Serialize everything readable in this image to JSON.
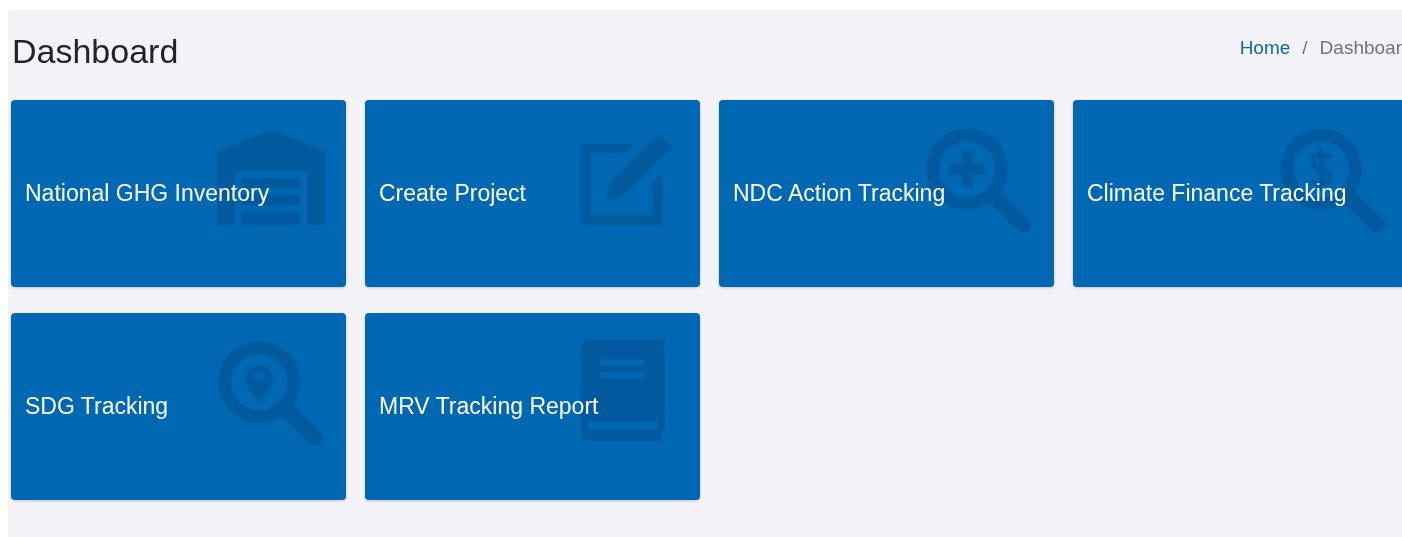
{
  "page": {
    "title": "Dashboard"
  },
  "breadcrumb": [
    {
      "label": "Home",
      "kind": "link"
    },
    {
      "label": "/",
      "kind": "separator"
    },
    {
      "label": "Dashboar",
      "kind": "current"
    }
  ],
  "tiles": [
    {
      "label": "National GHG Inventory",
      "kind": "warehouse"
    },
    {
      "label": "Create Project",
      "kind": "edit"
    },
    {
      "label": "NDC Action Tracking",
      "kind": "search-plus"
    },
    {
      "label": "Climate Finance Tracking",
      "kind": "search-dollar"
    },
    {
      "label": "SDG Tracking",
      "kind": "search-location"
    },
    {
      "label": "MRV Tracking Report",
      "kind": "book"
    }
  ]
}
